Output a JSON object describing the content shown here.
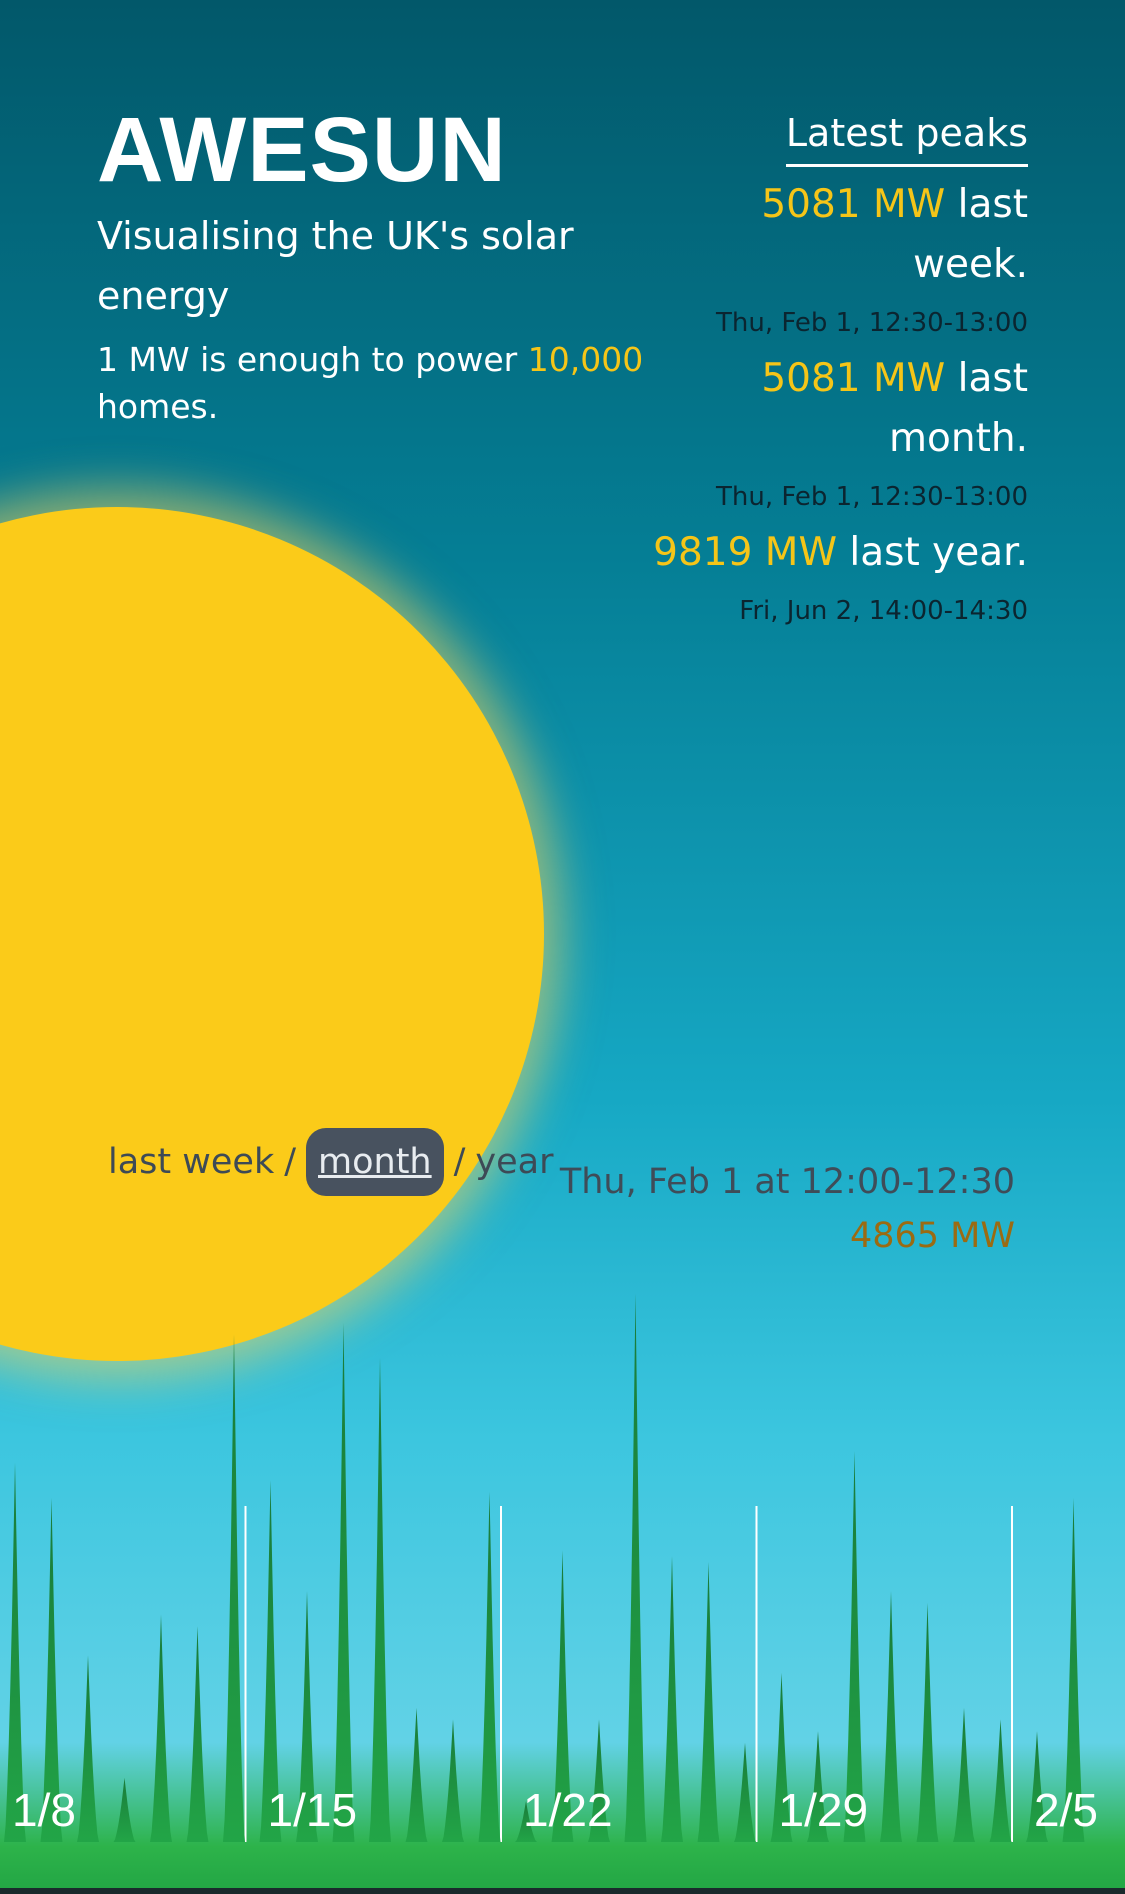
{
  "app": {
    "title": "AWESUN",
    "subtitle": "Visualising the UK's solar energy",
    "desc_prefix": "1 MW is enough to power ",
    "desc_highlight": "10,000",
    "desc_suffix": "homes."
  },
  "peaks": {
    "heading": "Latest peaks",
    "items": [
      {
        "value": "5081 MW",
        "label": "last week.",
        "time": "Thu, Feb 1, 12:30-13:00"
      },
      {
        "value": "5081 MW",
        "label": "last month.",
        "time": "Thu, Feb 1, 12:30-13:00"
      },
      {
        "value": "9819 MW",
        "label": "last year.",
        "time": "Fri, Jun 2, 14:00-14:30"
      }
    ]
  },
  "period": {
    "week": "last week",
    "month": "month",
    "year": "year",
    "sep": "/",
    "selected": "month"
  },
  "readout": {
    "time": "Thu, Feb 1 at 12:00-12:30",
    "value": "4865 MW"
  },
  "colors": {
    "highlight": "#f5c518",
    "sun": "#fbcb19",
    "bars": "#1f8f43"
  },
  "chart_data": {
    "type": "area",
    "x_tick_labels": [
      "1/8",
      "1/15",
      "1/22",
      "1/29",
      "2/5"
    ],
    "ylim": [
      0,
      5500
    ],
    "unit": "MW",
    "daily_peaks": [
      {
        "date": "1/6",
        "value": 1200
      },
      {
        "date": "1/7",
        "value": 500
      },
      {
        "date": "1/8",
        "value": 3250
      },
      {
        "date": "1/9",
        "value": 2950
      },
      {
        "date": "1/10",
        "value": 1600
      },
      {
        "date": "1/11",
        "value": 550
      },
      {
        "date": "1/12",
        "value": 1950
      },
      {
        "date": "1/13",
        "value": 1850
      },
      {
        "date": "1/14",
        "value": 4350
      },
      {
        "date": "1/15",
        "value": 3100
      },
      {
        "date": "1/16",
        "value": 2150
      },
      {
        "date": "1/17",
        "value": 4450
      },
      {
        "date": "1/18",
        "value": 4150
      },
      {
        "date": "1/19",
        "value": 1150
      },
      {
        "date": "1/20",
        "value": 1050
      },
      {
        "date": "1/21",
        "value": 3000
      },
      {
        "date": "1/22",
        "value": 350
      },
      {
        "date": "1/23",
        "value": 2500
      },
      {
        "date": "1/24",
        "value": 1050
      },
      {
        "date": "1/25",
        "value": 4700
      },
      {
        "date": "1/26",
        "value": 2450
      },
      {
        "date": "1/27",
        "value": 2400
      },
      {
        "date": "1/28",
        "value": 850
      },
      {
        "date": "1/29",
        "value": 1450
      },
      {
        "date": "1/30",
        "value": 950
      },
      {
        "date": "1/31",
        "value": 3350
      },
      {
        "date": "2/1",
        "value": 2150
      },
      {
        "date": "2/2",
        "value": 2050
      },
      {
        "date": "2/3",
        "value": 1150
      },
      {
        "date": "2/4",
        "value": 1050
      },
      {
        "date": "2/5",
        "value": 950
      },
      {
        "date": "2/6",
        "value": 2950
      }
    ]
  }
}
